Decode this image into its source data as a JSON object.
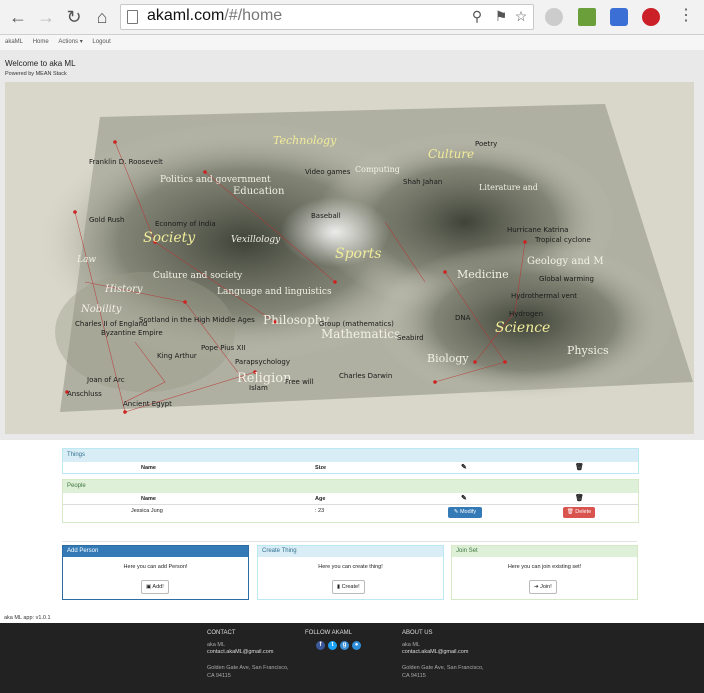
{
  "browser": {
    "url_host": "akaml.com",
    "url_path": "/#/home"
  },
  "navbar": {
    "brand": "akaML",
    "items": [
      "Home",
      "Actions ▾",
      "Logout"
    ]
  },
  "welcome": {
    "title": "Welcome to aka ML",
    "subtitle": "Powered by MEAN Stack"
  },
  "hero_map": {
    "bright_labels": [
      "Culture",
      "Society",
      "Sports",
      "Science",
      "Technology"
    ],
    "light_labels": [
      "Politics and government",
      "Education",
      "Culture and society",
      "Language and linguistics",
      "Philosophy",
      "Mathematics",
      "Religion",
      "Medicine",
      "Geology and M",
      "Physics",
      "Biology",
      "History",
      "Nobility",
      "Law",
      "Vexillology",
      "Literature and",
      "Computing"
    ],
    "small_labels": [
      "Franklin D. Roosevelt",
      "Gold Rush",
      "Charles II of England",
      "Scotland in the High Middle Ages",
      "Byzantine Empire",
      "King Arthur",
      "Pope Pius XII",
      "Parapsychology",
      "Joan of Arc",
      "Anschluss",
      "Ancient Egypt",
      "Islam",
      "Free will",
      "Charles Darwin",
      "Group (mathematics)",
      "DNA",
      "Seabird",
      "Hydrogen",
      "Global warming",
      "Tropical cyclone",
      "Hurricane Katrina",
      "Baseball",
      "Economy of India",
      "Hydrothermal vent",
      "Poetry",
      "Shah Jahan",
      "Video games"
    ]
  },
  "things": {
    "title": "Things",
    "columns": [
      "Name",
      "Size",
      "pencil-icon",
      "trash-icon"
    ]
  },
  "people": {
    "title": "People",
    "columns": [
      "Name",
      "Age",
      "pencil-icon",
      "trash-icon"
    ],
    "rows": [
      {
        "name": "Jessica Jung",
        "age": ": 23",
        "modify_label": "Modify",
        "delete_label": "Delete"
      }
    ]
  },
  "cards": {
    "add": {
      "title": "Add Person",
      "text": "Here you can add Person!",
      "button": "Add!"
    },
    "create": {
      "title": "Create Thing",
      "text": "Here you can create thing!",
      "button": "Create!"
    },
    "join": {
      "title": "Join Set",
      "text": "Here you can join existing set!",
      "button": "Join!"
    }
  },
  "version": "aka ML app: v1.0.1",
  "footer": {
    "contact": {
      "heading": "CONTACT",
      "name": "aka ML",
      "email": "contact.akaML@gmail.com",
      "address1": "Golden Gate Ave, San Francisco,",
      "address2": "CA 94115"
    },
    "follow": {
      "heading": "FOLLOW AKAML",
      "icons": [
        "facebook-icon",
        "twitter-icon",
        "google-plus-icon",
        "github-icon"
      ]
    },
    "about": {
      "heading": "ABOUT US",
      "name": "aka ML",
      "email": "contact.akaML@gmail.com",
      "address1": "Golden Gate Ave, San Francisco,",
      "address2": "CA 94115"
    }
  },
  "colors": {
    "primary": "#337ab7",
    "danger": "#d9534f",
    "info_bg": "#d9edf7",
    "success_bg": "#dff0d8",
    "footer_bg": "#222222"
  }
}
